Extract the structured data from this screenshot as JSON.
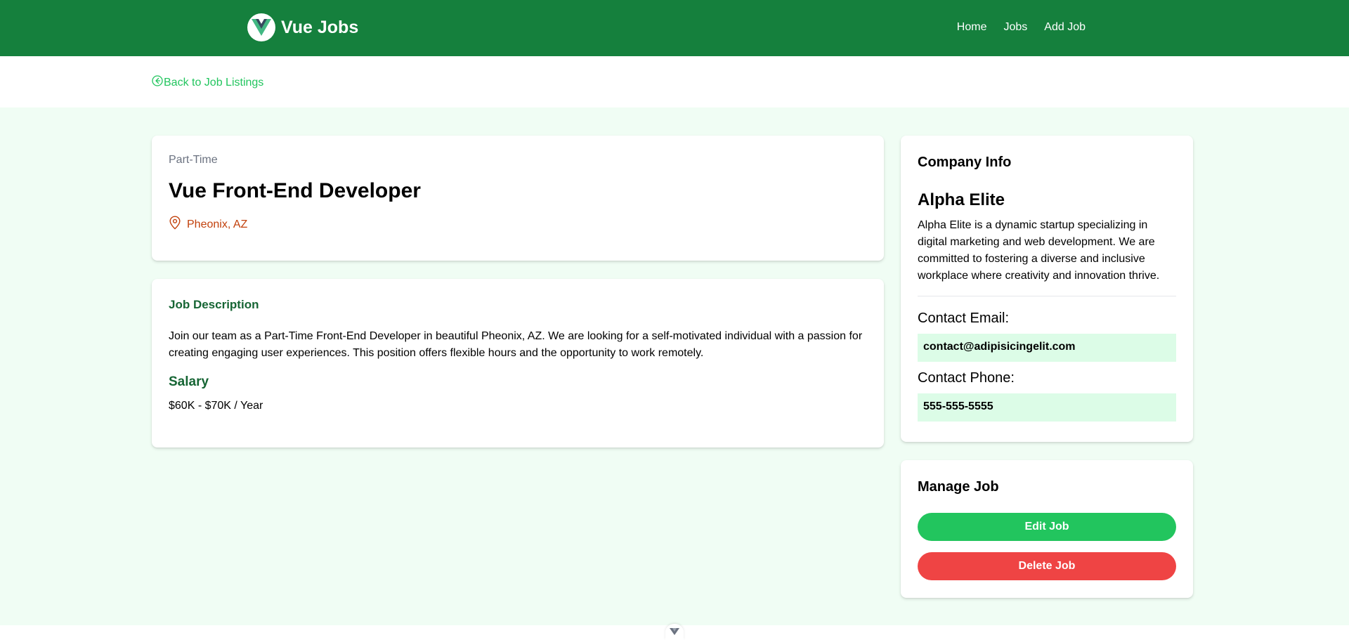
{
  "navbar": {
    "brand": "Vue Jobs",
    "links": [
      "Home",
      "Jobs",
      "Add Job"
    ],
    "color": "#15803d"
  },
  "back_link": "Back to Job Listings",
  "job": {
    "type": "Part-Time",
    "title": "Vue Front-End Developer",
    "location": "Pheonix, AZ",
    "description_heading": "Job Description",
    "description": "Join our team as a Part-Time Front-End Developer in beautiful Pheonix, AZ. We are looking for a self-motivated individual with a passion for creating engaging user experiences. This position offers flexible hours and the opportunity to work remotely.",
    "salary_heading": "Salary",
    "salary": "$60K - $70K / Year"
  },
  "company": {
    "heading": "Company Info",
    "name": "Alpha Elite",
    "description": "Alpha Elite is a dynamic startup specializing in digital marketing and web development. We are committed to fostering a diverse and inclusive workplace where creativity and innovation thrive.",
    "email_label": "Contact Email:",
    "email": "contact@adipisicingelit.com",
    "phone_label": "Contact Phone:",
    "phone": "555-555-5555"
  },
  "manage": {
    "heading": "Manage Job",
    "edit_label": "Edit Job",
    "delete_label": "Delete Job"
  },
  "colors": {
    "accent": "#22c55e",
    "danger": "#ef4444",
    "location": "#c2410c",
    "page_bg": "#f0fdf4"
  }
}
